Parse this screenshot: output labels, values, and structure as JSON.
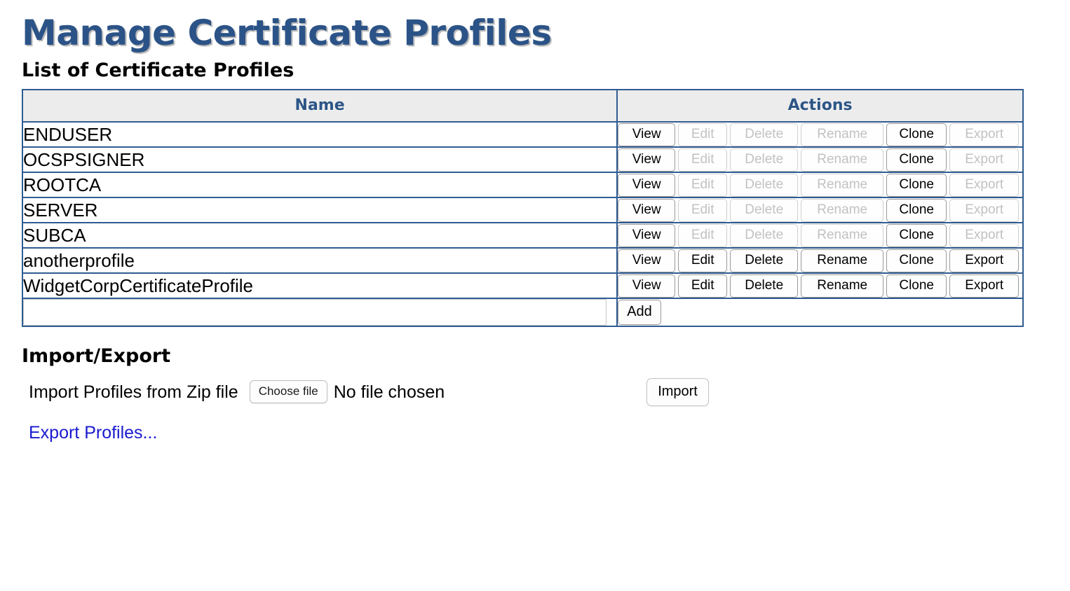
{
  "page": {
    "title": "Manage Certificate Profiles"
  },
  "list_section": {
    "heading": "List of Certificate Profiles",
    "columns": {
      "name": "Name",
      "actions": "Actions"
    },
    "action_labels": {
      "view": "View",
      "edit": "Edit",
      "delete": "Delete",
      "rename": "Rename",
      "clone": "Clone",
      "export": "Export"
    },
    "rows": [
      {
        "name": "ENDUSER",
        "view_enabled": true,
        "edit_enabled": false,
        "delete_enabled": false,
        "rename_enabled": false,
        "clone_enabled": true,
        "export_enabled": false
      },
      {
        "name": "OCSPSIGNER",
        "view_enabled": true,
        "edit_enabled": false,
        "delete_enabled": false,
        "rename_enabled": false,
        "clone_enabled": true,
        "export_enabled": false
      },
      {
        "name": "ROOTCA",
        "view_enabled": true,
        "edit_enabled": false,
        "delete_enabled": false,
        "rename_enabled": false,
        "clone_enabled": true,
        "export_enabled": false
      },
      {
        "name": "SERVER",
        "view_enabled": true,
        "edit_enabled": false,
        "delete_enabled": false,
        "rename_enabled": false,
        "clone_enabled": true,
        "export_enabled": false
      },
      {
        "name": "SUBCA",
        "view_enabled": true,
        "edit_enabled": false,
        "delete_enabled": false,
        "rename_enabled": false,
        "clone_enabled": true,
        "export_enabled": false
      },
      {
        "name": "anotherprofile",
        "view_enabled": true,
        "edit_enabled": true,
        "delete_enabled": true,
        "rename_enabled": true,
        "clone_enabled": true,
        "export_enabled": true
      },
      {
        "name": "WidgetCorpCertificateProfile",
        "view_enabled": true,
        "edit_enabled": true,
        "delete_enabled": true,
        "rename_enabled": true,
        "clone_enabled": true,
        "export_enabled": true
      }
    ],
    "add_row": {
      "input_value": "",
      "input_placeholder": "",
      "add_label": "Add"
    }
  },
  "import_export": {
    "heading": "Import/Export",
    "import_label": "Import Profiles from Zip file",
    "choose_file_label": "Choose file",
    "no_file_text": "No file chosen",
    "import_button_label": "Import",
    "export_link_label": "Export Profiles..."
  },
  "colors": {
    "title_blue": "#2b5387",
    "header_text_blue": "#2c5586",
    "table_border_blue": "#2f5c92",
    "header_bg": "#ececec",
    "link_blue": "#1a1ad0",
    "disabled_text": "#c2c2c2"
  }
}
